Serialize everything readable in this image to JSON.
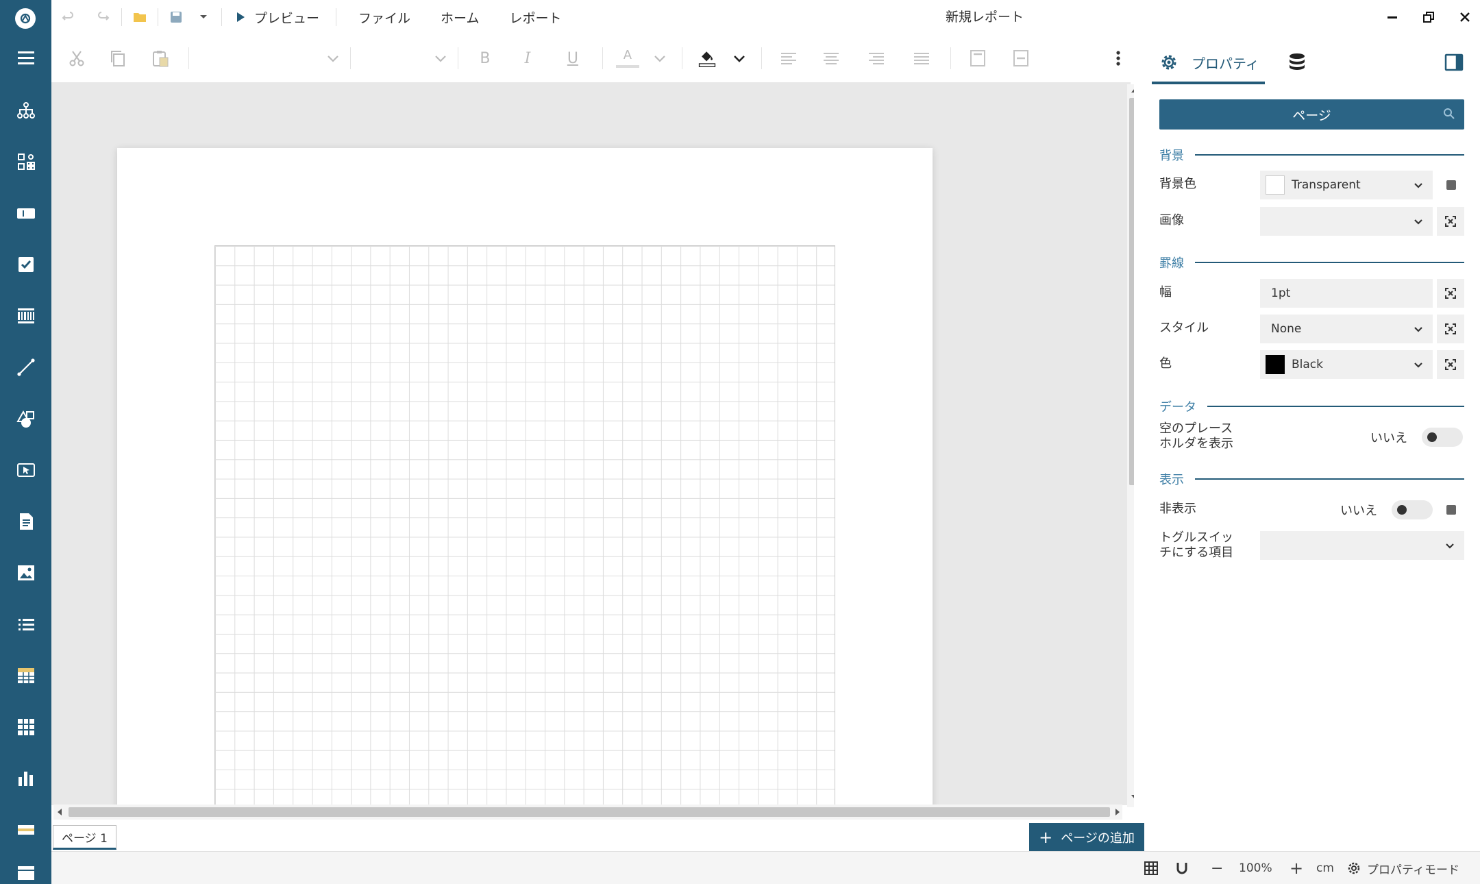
{
  "app": {
    "window_title": "新規レポート"
  },
  "menubar": {
    "preview_label": "プレビュー",
    "items": [
      "ファイル",
      "ホーム",
      "レポート"
    ]
  },
  "leftbar": {
    "items": [
      "hamburger-menu-icon",
      "hierarchy-icon",
      "components-icon",
      "textbox-icon",
      "checkbox-icon",
      "barcode-grid-icon",
      "line-icon",
      "shapes-icon",
      "input-field-icon",
      "richtext-icon",
      "image-icon",
      "list-icon",
      "table-icon",
      "tablix-icon",
      "chart-icon",
      "bandlist-icon",
      "more-icon"
    ]
  },
  "toolbar": {
    "bold": "B",
    "italic": "I",
    "underline": "U",
    "font_color_letter": "A"
  },
  "properties": {
    "tab_label": "プロパティ",
    "selector": "ページ",
    "sections": {
      "background": "背景",
      "border": "罫線",
      "data": "データ",
      "display": "表示"
    },
    "labels": {
      "bg_color": "背景色",
      "image": "画像",
      "width": "幅",
      "style": "スタイル",
      "color": "色",
      "show_placeholder": "空のプレースホルダを表示",
      "hidden": "非表示",
      "toggle_item": "トグルスイッチにする項目"
    },
    "values": {
      "bg_color": "Transparent",
      "image": "",
      "width": "1pt",
      "style": "None",
      "color": "Black",
      "show_placeholder": "いいえ",
      "hidden": "いいえ",
      "toggle_item": ""
    },
    "colors": {
      "bg_swatch": "#ffffff",
      "border_swatch": "#000000",
      "accent": "#235a78"
    }
  },
  "pages": {
    "tab_label": "ページ 1",
    "add_label": "ページの追加"
  },
  "status": {
    "zoom": "100%",
    "unit": "cm",
    "mode": "プロパティモード",
    "minus": "−",
    "plus": "+"
  }
}
